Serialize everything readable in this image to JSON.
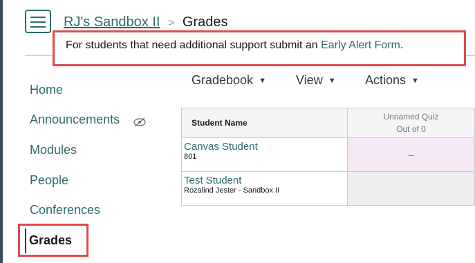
{
  "header": {
    "course_link": "RJ's Sandbox II",
    "separator": ">",
    "current_page": "Grades"
  },
  "alert": {
    "text": "For students that need additional support submit an ",
    "link": "Early Alert Form",
    "suffix": "."
  },
  "sidebar": {
    "items": [
      {
        "label": "Home"
      },
      {
        "label": "Announcements",
        "icon": "eye-off-icon"
      },
      {
        "label": "Modules"
      },
      {
        "label": "People"
      },
      {
        "label": "Conferences"
      },
      {
        "label": "Grades",
        "active": true
      }
    ]
  },
  "toolbar": {
    "gradebook": "Gradebook",
    "view": "View",
    "actions": "Actions",
    "caret": "▼"
  },
  "gradebook": {
    "col_student": "Student Name",
    "col_quiz_title": "Unnamed Quiz",
    "col_quiz_sub": "Out of 0",
    "rows": [
      {
        "name": "Canvas Student",
        "sub": "801",
        "grade": "–"
      },
      {
        "name": "Test Student",
        "sub": "Rozalind Jester - Sandbox II",
        "grade": ""
      }
    ]
  },
  "colors": {
    "link": "#2d6a6a",
    "highlight_border": "#e04a4a",
    "grade_cell_pink": "#f6e8f5"
  }
}
